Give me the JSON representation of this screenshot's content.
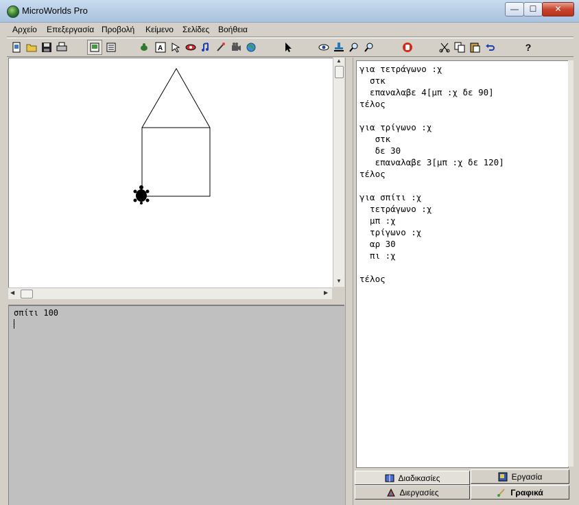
{
  "window": {
    "title": "MicroWorlds Pro",
    "controls": {
      "minimize": "—",
      "maximize": "☐",
      "close": "✕"
    }
  },
  "menu": [
    "Αρχείο",
    "Επεξεργασία",
    "Προβολή",
    "Κείμενο",
    "Σελίδες",
    "Βοήθεια"
  ],
  "toolbar": {
    "icons": [
      "new-page-icon",
      "open-icon",
      "save-icon",
      "print-icon",
      "page-view-icon",
      "text-view-icon",
      "turtle-hatch-icon",
      "textbox-icon",
      "button-icon",
      "slider-icon",
      "music-icon",
      "paint-icon",
      "video-icon",
      "globe-icon",
      "pointer-icon",
      "eye-icon",
      "stamp-icon",
      "zoom-in-icon",
      "zoom-out-icon",
      "stop-icon",
      "cut-icon",
      "copy-icon",
      "paste-icon",
      "undo-icon",
      "help-icon"
    ],
    "help_label": "?"
  },
  "command_center": {
    "text": "σπίτι 100"
  },
  "procedures": {
    "lines": [
      "για τετράγωνο :χ",
      "  στκ",
      "  επαναλαβε 4[μπ :χ δε 90]",
      "τέλος",
      "",
      "για τρίγωνο :χ",
      "   στκ",
      "   δε 30",
      "   επαναλαβε 3[μπ :χ δε 120]",
      "τέλος",
      "",
      "για σπίτι :χ",
      "  τετράγωνο :χ",
      "  μπ :χ",
      "  τρίγωνο :χ",
      "  αρ 30",
      "  πι :χ",
      "",
      "τέλος"
    ]
  },
  "tabs": {
    "procedures": "Διαδικασίες",
    "project": "Εργασία",
    "processes": "Διεργασίες",
    "graphics": "Γραφικά"
  },
  "drawing": {
    "description_shape": "house",
    "turtle_color": "#000000",
    "line_color": "#000000"
  }
}
